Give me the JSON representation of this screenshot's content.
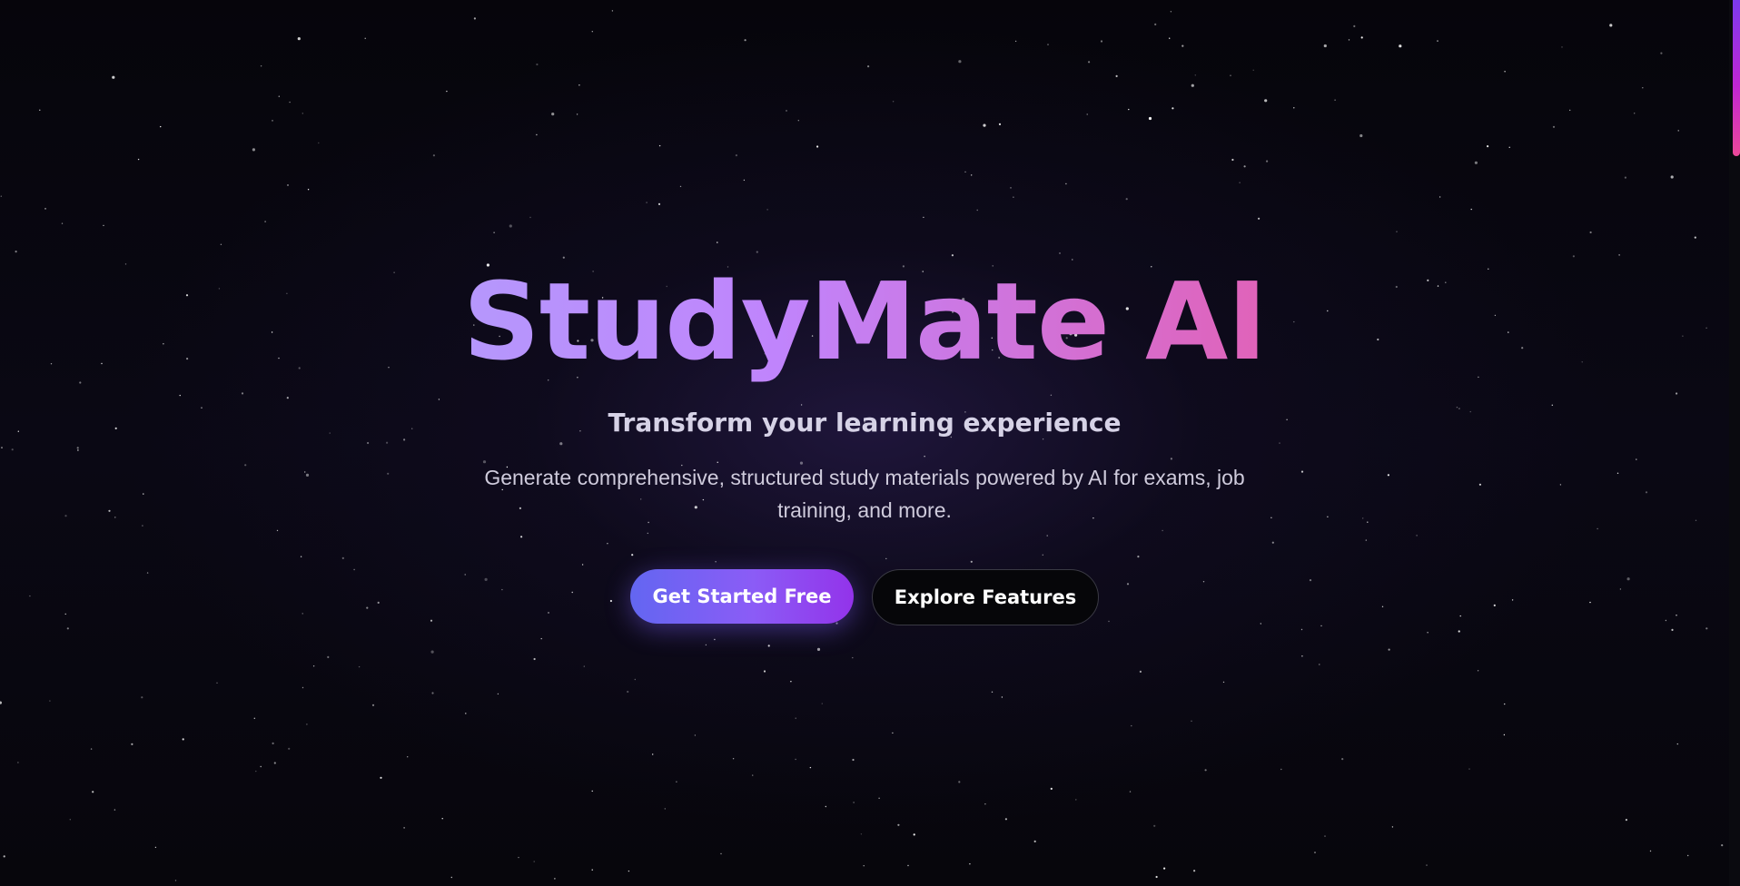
{
  "hero": {
    "title": "StudyMate AI",
    "subtitle": "Transform your learning experience",
    "description": "Generate comprehensive, structured study materials powered by AI for exams, job training, and more."
  },
  "cta": {
    "primary_label": "Get Started Free",
    "secondary_label": "Explore Features"
  },
  "colors": {
    "background": "#05040a",
    "title_gradient": [
      "#a5b4fc",
      "#c084fc",
      "#ec4899"
    ],
    "primary_button_gradient": [
      "#6366f1",
      "#9333ea"
    ],
    "scrollbar_gradient": [
      "#7c3aed",
      "#ec4899"
    ]
  }
}
